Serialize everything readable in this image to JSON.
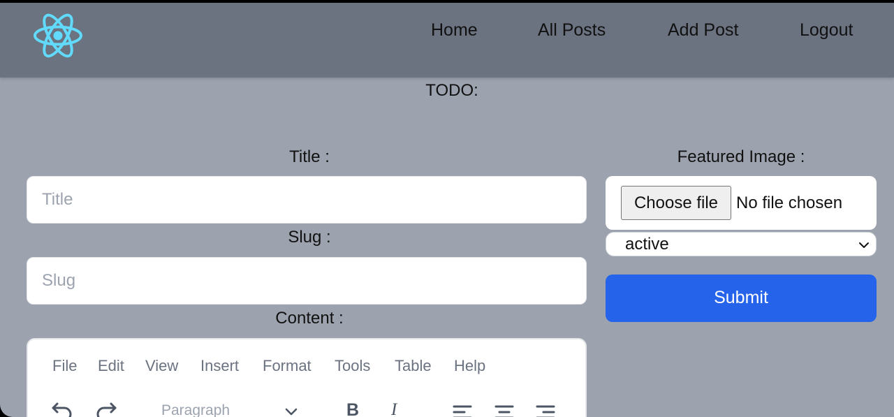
{
  "nav": {
    "home": "Home",
    "all_posts": "All Posts",
    "add_post": "Add Post",
    "logout": "Logout"
  },
  "page": {
    "todo": "TODO:"
  },
  "form": {
    "title_label": "Title :",
    "title_placeholder": "Title",
    "slug_label": "Slug :",
    "slug_placeholder": "Slug",
    "content_label": "Content :",
    "featured_label": "Featured Image :",
    "choose_file": "Choose file",
    "no_file": "No file chosen",
    "status_value": "active",
    "submit": "Submit"
  },
  "editor": {
    "menu": [
      "File",
      "Edit",
      "View",
      "Insert",
      "Format",
      "Tools",
      "Table",
      "Help"
    ],
    "block_format": "Paragraph",
    "bold": "B",
    "italic": "I"
  },
  "colors": {
    "header_bg": "#6b7280",
    "page_bg": "#9ca3af",
    "submit_bg": "#2563eb",
    "logo": "#61dafb"
  },
  "icons": {
    "logo": "react-logo-icon",
    "select": "chevron-down-icon",
    "undo": "undo-icon",
    "redo": "redo-icon",
    "align_left": "align-left-icon",
    "align_center": "align-center-icon",
    "align_right": "align-right-icon"
  }
}
